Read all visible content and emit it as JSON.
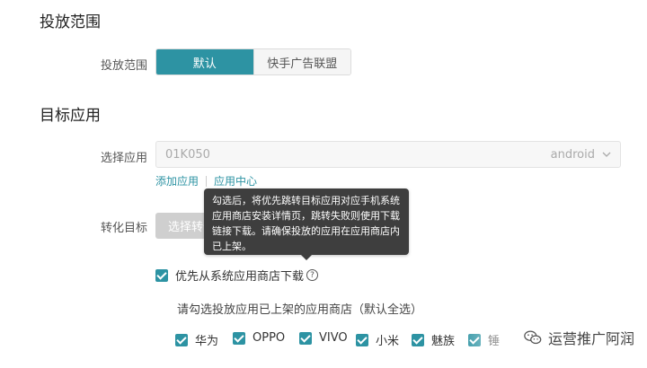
{
  "sections": {
    "delivery_title": "投放范围",
    "target_title": "目标应用"
  },
  "delivery": {
    "label": "投放范围",
    "options": [
      "默认",
      "快手广告联盟"
    ],
    "selected": "默认"
  },
  "app_select": {
    "label": "选择应用",
    "value": "01K050",
    "platform": "android"
  },
  "links": {
    "add_app": "添加应用",
    "app_center": "应用中心"
  },
  "conversion": {
    "label": "转化目标",
    "button_label": "选择转化目标"
  },
  "tooltip": {
    "lines": [
      "勾选后，将优先跳转目标应用对应手机系统",
      "应用商店安装详情页，跳转失败则使用下载",
      "链接下载。请确保投放的应用在应用商店内",
      "已上架。"
    ]
  },
  "prefer_store": {
    "label": "优先从系统应用商店下载",
    "checked": true
  },
  "store_hint": "请勾选投放应用已上架的应用商店（默认全选）",
  "stores": [
    {
      "label": "华为",
      "checked": true
    },
    {
      "label": "OPPO",
      "checked": true
    },
    {
      "label": "VIVO",
      "checked": true
    },
    {
      "label": "小米",
      "checked": true
    },
    {
      "label": "魅族",
      "checked": true
    },
    {
      "label": "锤",
      "checked": true
    }
  ],
  "watermark": "运营推广阿润",
  "colors": {
    "accent": "#2d93a3",
    "tooltip_bg": "#3e3e3e"
  }
}
